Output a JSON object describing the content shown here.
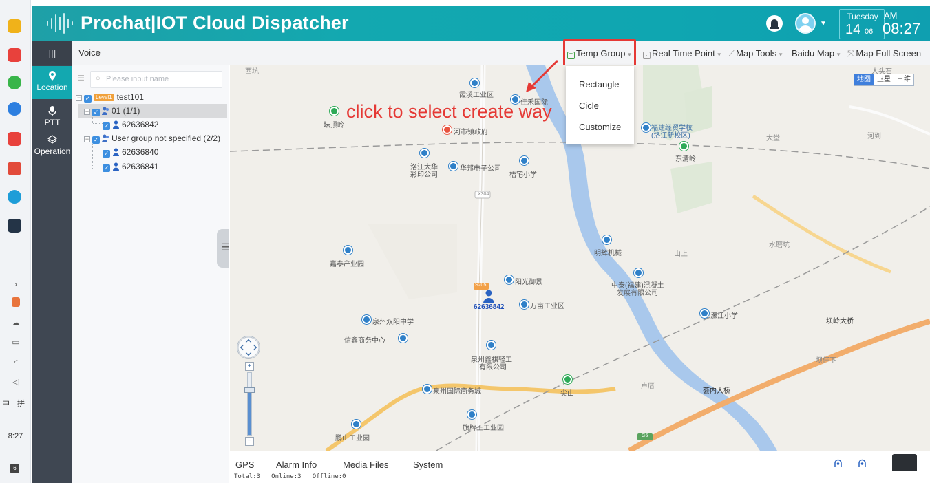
{
  "header": {
    "title": "Prochat|IOT Cloud Dispatcher",
    "weekday": "Tuesday",
    "day": "14",
    "month": "06",
    "ampm": "AM",
    "time": "08:27"
  },
  "toolbar": {
    "voice_label": "Voice",
    "tools": [
      "Temp Group",
      "Real Time Point",
      "Map Tools",
      "Baidu Map",
      "Map Full Screen"
    ]
  },
  "nav": {
    "items": [
      "Location",
      "PTT",
      "Operation"
    ]
  },
  "tree": {
    "search_placeholder": "Please input name",
    "level_badge": "Level1",
    "root": "test101",
    "group1": "01 (1/1)",
    "user1": "62636842",
    "group2": "User group not specified (2/2)",
    "user2": "62636840",
    "user3": "62636841"
  },
  "temp_menu": {
    "items": [
      "Rectangle",
      "Cicle",
      "Customize"
    ]
  },
  "annotation": {
    "text": "click to select create way"
  },
  "map": {
    "device_id": "62636842",
    "map_types": [
      "地图",
      "卫星",
      "三维"
    ],
    "labels": {
      "l1": "西坑",
      "l2": "霞溪工业区",
      "l3": "佳禾国际",
      "l4": "坛顶岭",
      "l5": "河市镇政府",
      "l6": "福建经贸学校",
      "l7": "(洛江新校区)",
      "l8": "大堂",
      "l9": "河到",
      "l10": "东清岭",
      "l11": "洛江大华",
      "l12": "彩印公司",
      "l13": "华邦电子公司",
      "l14": "梧宅小学",
      "l15": "X304",
      "l16": "嘉泰产业园",
      "l17": "明辉机械",
      "l18": "山上",
      "l19": "水磨坑",
      "l20": "阳光御景",
      "l21": "中泰(福建)混凝土",
      "l22": "发展有限公司",
      "l23": "万亩工业区",
      "l24": "泉州双阳中学",
      "l25": "濠江小学",
      "l26": "坝岭大桥",
      "l27": "信鑫商务中心",
      "l28": "泉州鑫祺轻工",
      "l29": "有限公司",
      "l30": "坝仔下",
      "l31": "泉州国际商务城",
      "l32": "尖山",
      "l33": "卢厝",
      "l34": "荟内大桥",
      "l35": "鹏山工业园",
      "l36": "旗牌王工业园",
      "l37": "S205",
      "l38": "人头石",
      "l39": "G6"
    }
  },
  "bottom_tabs": [
    "GPS",
    "Alarm Info",
    "Media Files",
    "System"
  ],
  "status": {
    "text": "Total:3   Online:3   Offline:0"
  },
  "taskbar": {
    "time": "8:27",
    "ime1": "中",
    "ime2": "拼",
    "notif_count": "6"
  },
  "colors": {
    "header": "#13a8b0",
    "nav_dark": "#3f4752",
    "nav_active": "#13a8b0",
    "annotation_red": "#e53935"
  }
}
